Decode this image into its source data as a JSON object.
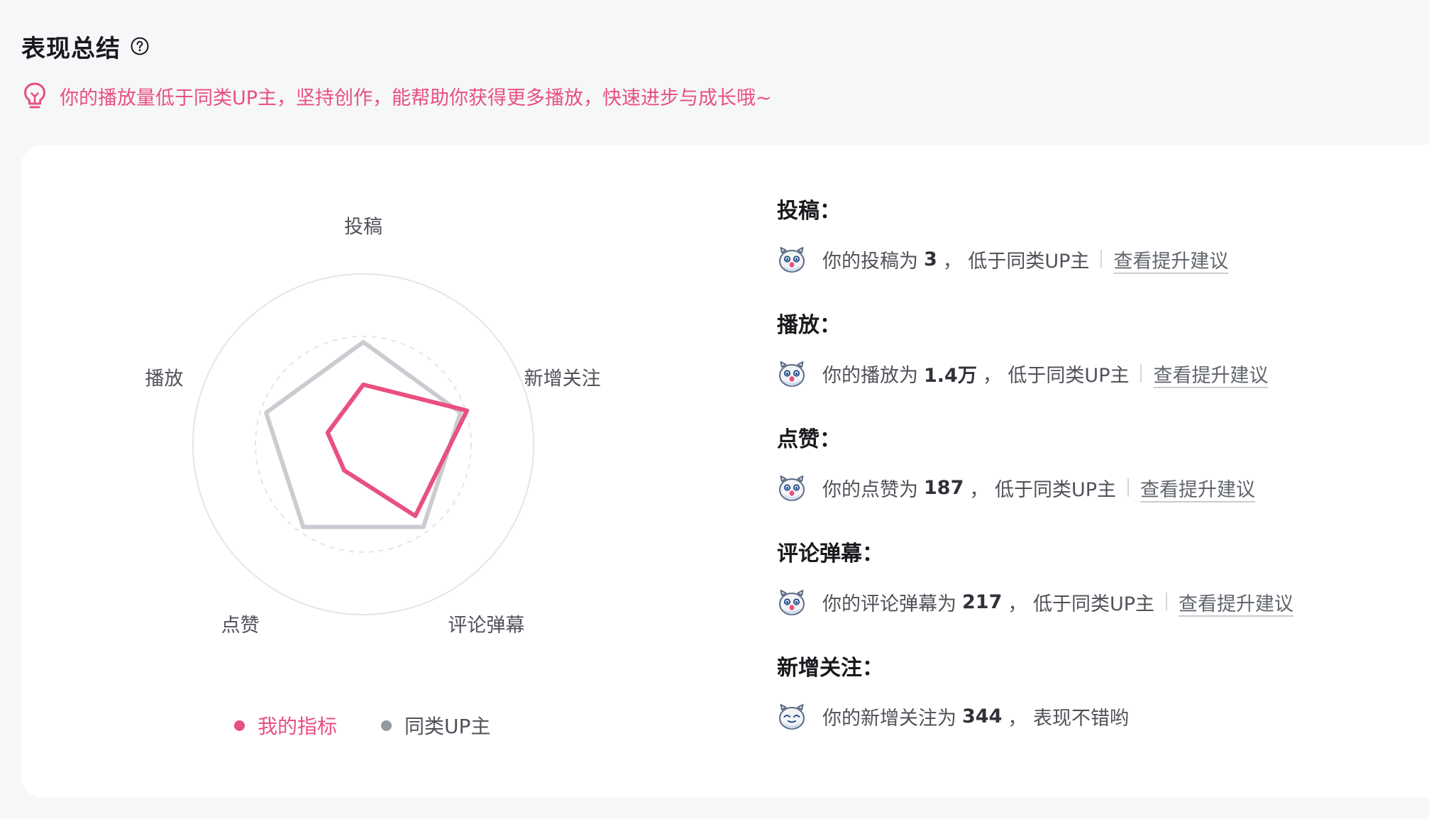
{
  "header": {
    "title": "表现总结",
    "help_icon": "question-circle-icon"
  },
  "tip": {
    "icon": "lightbulb-icon",
    "text": "你的播放量低于同类UP主，坚持创作，能帮助你获得更多播放，快速进步与成长哦~"
  },
  "colors": {
    "accent": "#e8507f",
    "peer": "#c9ccd0",
    "legend_peer_dot": "#9499a0"
  },
  "chart_data": {
    "type": "radar",
    "axes": [
      "投稿",
      "新增关注",
      "评论弹幕",
      "点赞",
      "播放"
    ],
    "series": [
      {
        "name": "我的指标",
        "values": [
          0.35,
          0.64,
          0.52,
          0.19,
          0.22
        ]
      },
      {
        "name": "同类UP主",
        "values": [
          0.6,
          0.6,
          0.6,
          0.6,
          0.6
        ]
      }
    ],
    "range": [
      0,
      1
    ],
    "reference_ring": 0.5
  },
  "legend": {
    "mine": "我的指标",
    "peer": "同类UP主"
  },
  "metrics": [
    {
      "title": "投稿：",
      "prefix": "你的投稿为",
      "value": "3",
      "suffix": "，  低于同类UP主",
      "link": "查看提升建议",
      "face": "worried-face-icon"
    },
    {
      "title": "播放：",
      "prefix": "你的播放为",
      "value": "1.4万",
      "suffix": "，  低于同类UP主",
      "link": "查看提升建议",
      "face": "worried-face-icon"
    },
    {
      "title": "点赞：",
      "prefix": "你的点赞为",
      "value": "187",
      "suffix": "，  低于同类UP主",
      "link": "查看提升建议",
      "face": "worried-face-icon"
    },
    {
      "title": "评论弹幕：",
      "prefix": "你的评论弹幕为",
      "value": "217",
      "suffix": "，  低于同类UP主",
      "link": "查看提升建议",
      "face": "worried-face-icon"
    },
    {
      "title": "新增关注：",
      "prefix": "你的新增关注为",
      "value": "344",
      "suffix": "，  表现不错哟",
      "face": "happy-face-icon"
    }
  ]
}
